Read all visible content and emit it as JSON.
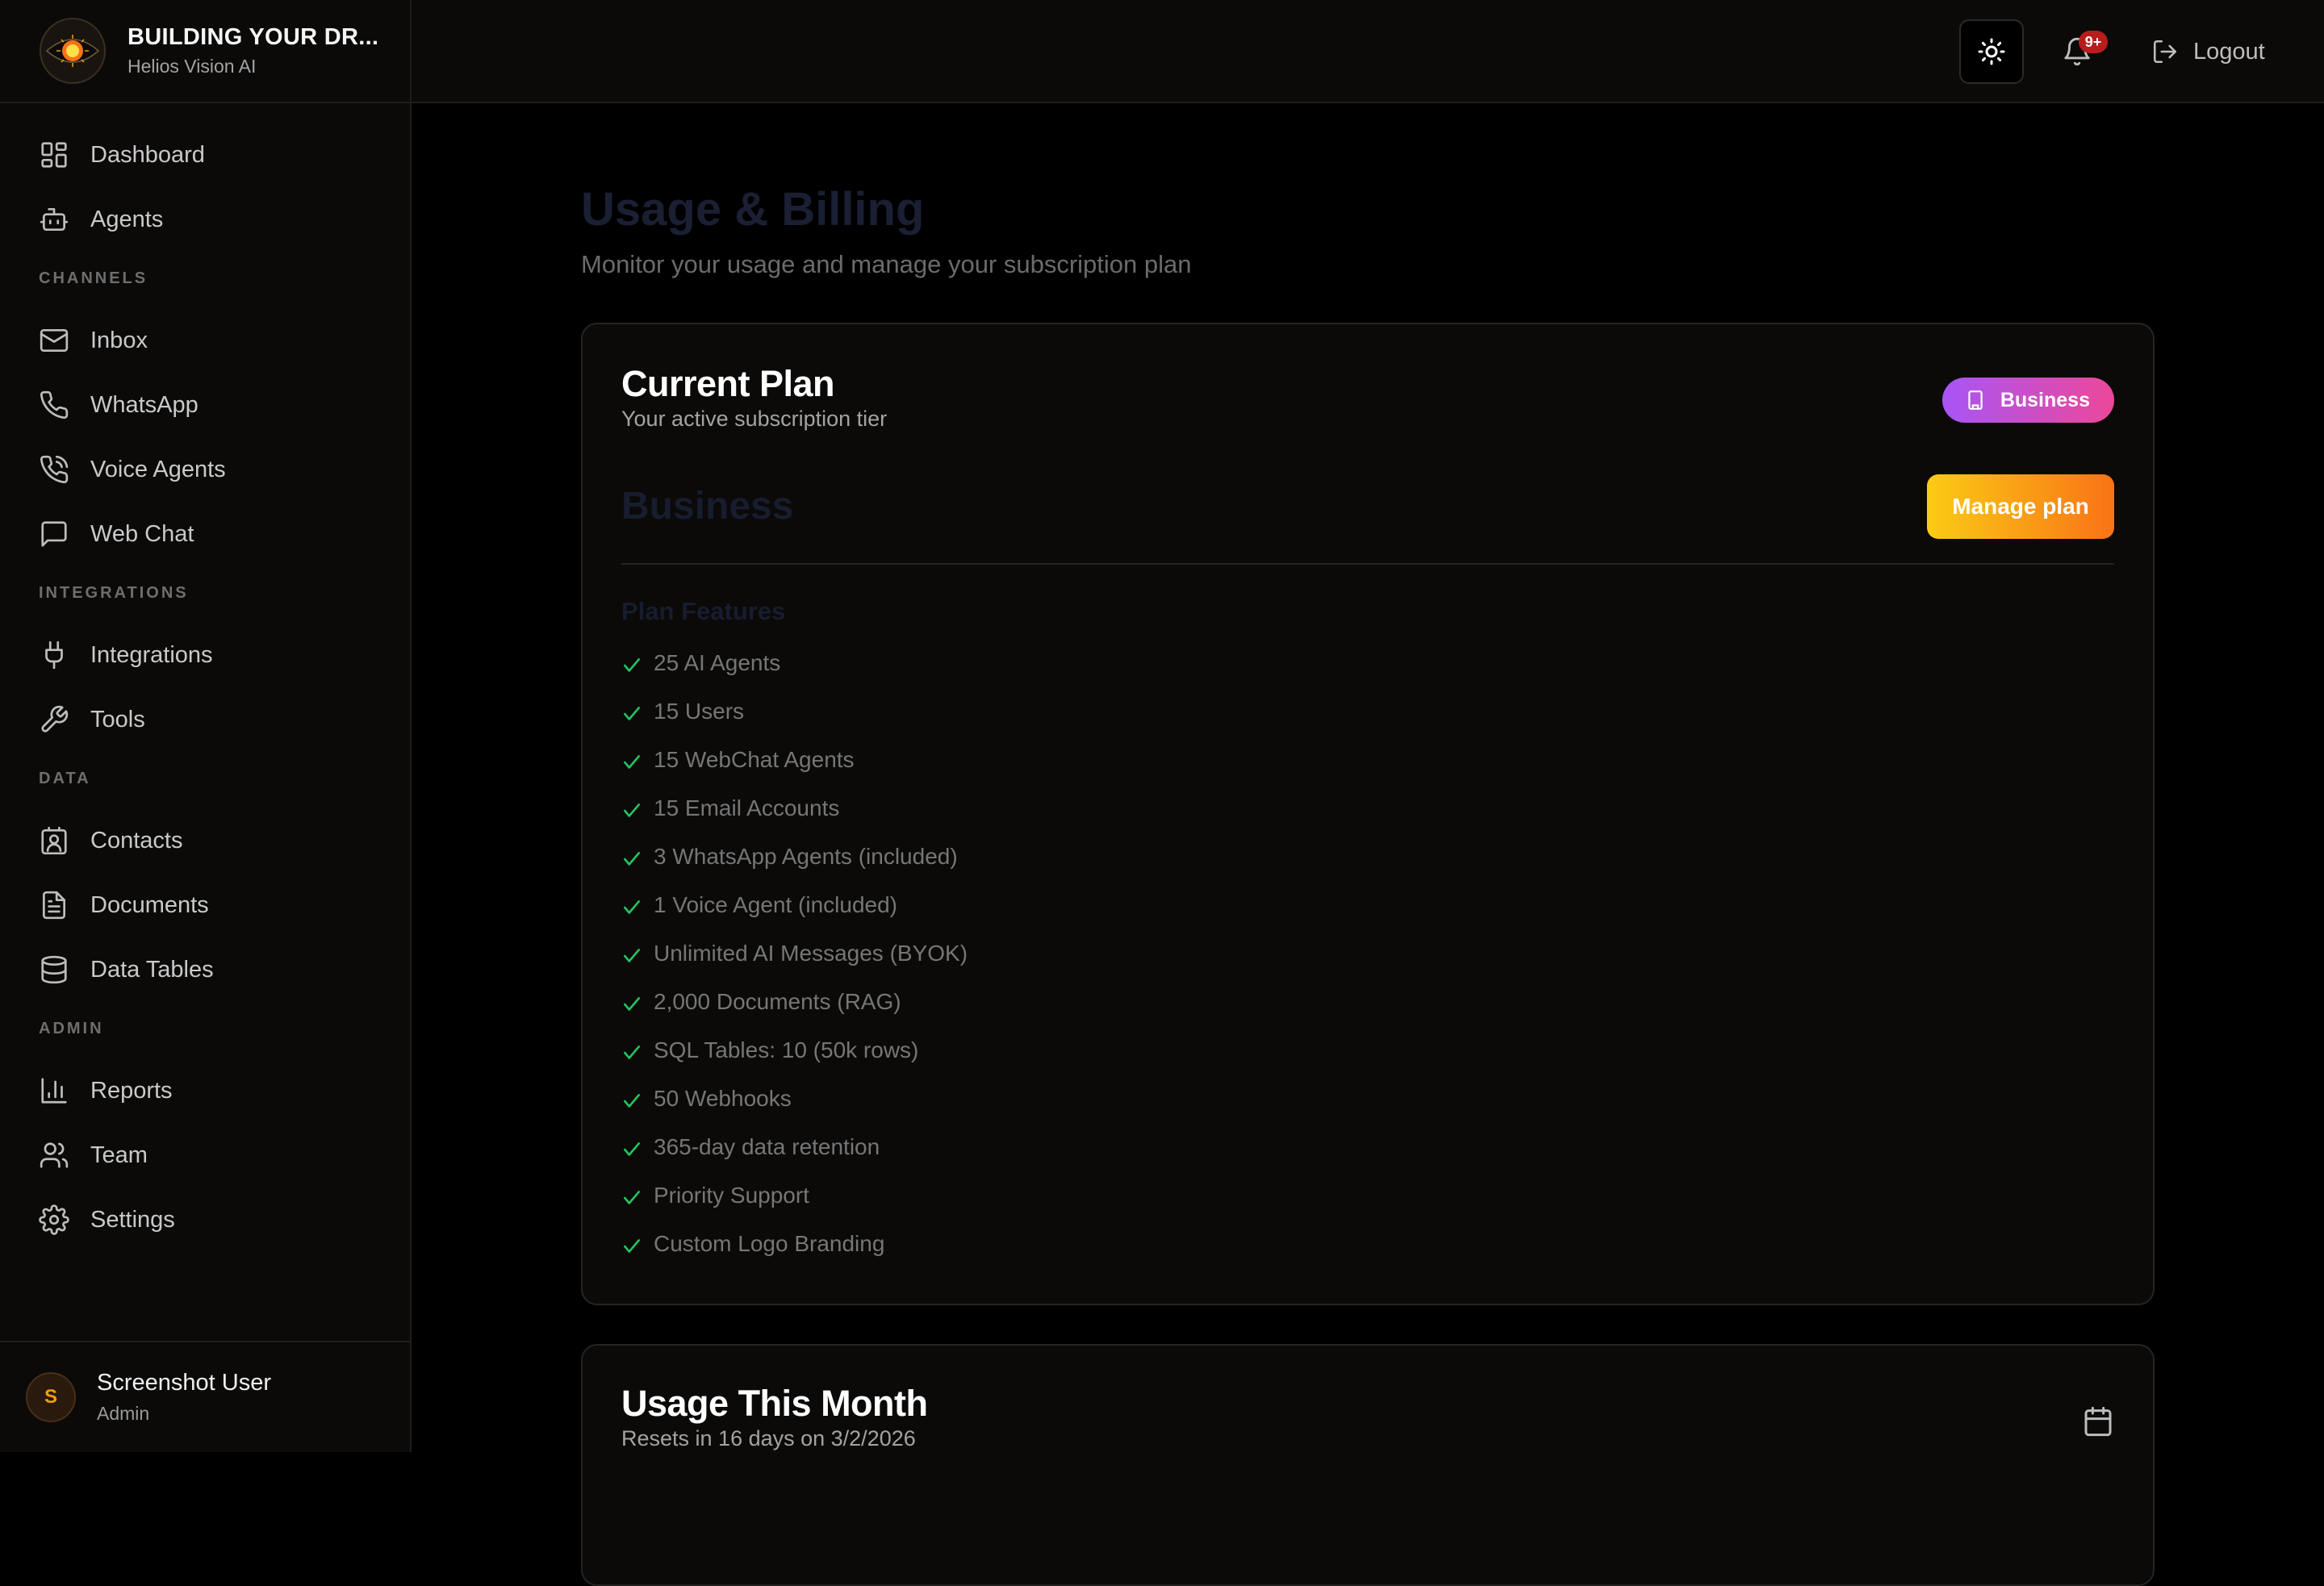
{
  "brand": {
    "title": "BUILDING YOUR DR...",
    "subtitle": "Helios Vision AI",
    "logo_icon": "sun-eye-logo-icon"
  },
  "sidebar": {
    "items_top": [
      {
        "label": "Dashboard",
        "icon": "grid-icon"
      },
      {
        "label": "Agents",
        "icon": "bot-icon"
      }
    ],
    "sections": [
      {
        "title": "CHANNELS",
        "items": [
          {
            "label": "Inbox",
            "icon": "mail-icon"
          },
          {
            "label": "WhatsApp",
            "icon": "phone-icon"
          },
          {
            "label": "Voice Agents",
            "icon": "phone-call-icon"
          },
          {
            "label": "Web Chat",
            "icon": "chat-icon"
          }
        ]
      },
      {
        "title": "INTEGRATIONS",
        "items": [
          {
            "label": "Integrations",
            "icon": "plug-icon"
          },
          {
            "label": "Tools",
            "icon": "wrench-icon"
          }
        ]
      },
      {
        "title": "DATA",
        "items": [
          {
            "label": "Contacts",
            "icon": "contact-icon"
          },
          {
            "label": "Documents",
            "icon": "document-icon"
          },
          {
            "label": "Data Tables",
            "icon": "database-icon"
          }
        ]
      },
      {
        "title": "ADMIN",
        "items": [
          {
            "label": "Reports",
            "icon": "chart-icon"
          },
          {
            "label": "Team",
            "icon": "users-icon"
          },
          {
            "label": "Settings",
            "icon": "gear-icon"
          }
        ]
      }
    ]
  },
  "user": {
    "initial": "S",
    "name": "Screenshot User",
    "role": "Admin"
  },
  "topbar": {
    "notifications_badge": "9+",
    "logout_label": "Logout"
  },
  "page": {
    "title": "Usage & Billing",
    "subtitle": "Monitor your usage and manage your subscription plan"
  },
  "plan_card": {
    "title": "Current Plan",
    "subtitle": "Your active subscription tier",
    "badge": "Business",
    "plan_name": "Business",
    "manage_label": "Manage plan",
    "features_title": "Plan Features",
    "features": [
      "25 AI Agents",
      "15 Users",
      "15 WebChat Agents",
      "15 Email Accounts",
      "3 WhatsApp Agents (included)",
      "1 Voice Agent (included)",
      "Unlimited AI Messages (BYOK)",
      "2,000 Documents (RAG)",
      "SQL Tables: 10 (50k rows)",
      "50 Webhooks",
      "365-day data retention",
      "Priority Support",
      "Custom Logo Branding"
    ]
  },
  "usage_card": {
    "title": "Usage This Month",
    "subtitle": "Resets in 16 days on 3/2/2026"
  },
  "colors": {
    "accent_purple": "#a855f7",
    "accent_pink": "#ec4899",
    "accent_yellow": "#facc15",
    "accent_orange": "#f97316",
    "check_green": "#22c55e",
    "badge_red": "#b91c1c"
  }
}
